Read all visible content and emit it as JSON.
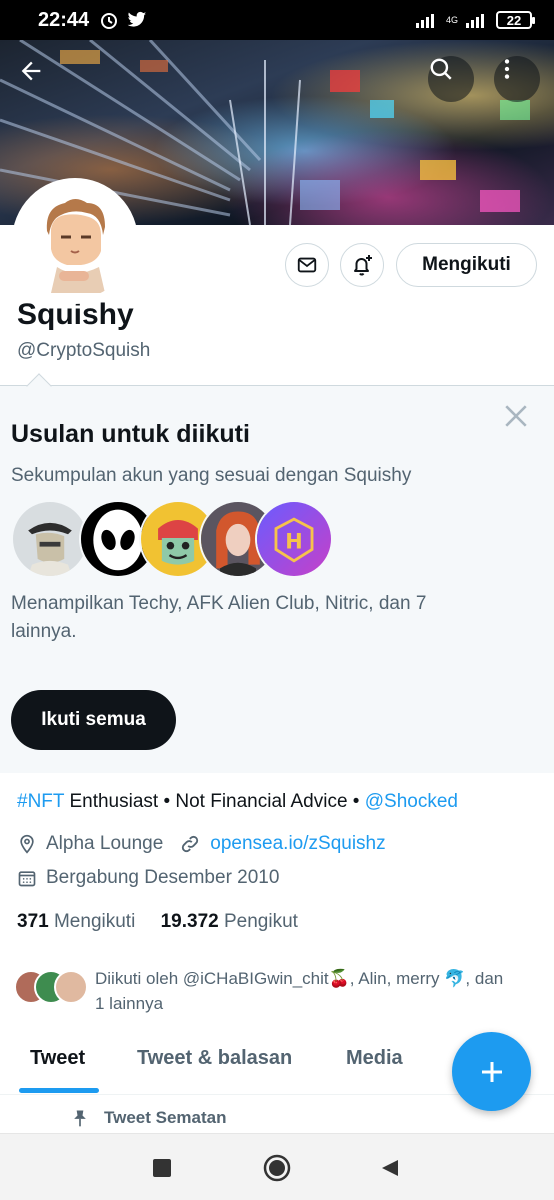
{
  "status_bar": {
    "time": "22:44",
    "network": "4G",
    "battery": "22"
  },
  "header": {
    "back_icon": "arrow-left-icon",
    "search_icon": "search-icon",
    "more_icon": "more-vertical-icon"
  },
  "profile": {
    "name": "Squishy",
    "handle": "@CryptoSquish",
    "follow_button": "Mengikuti",
    "bio_hashtag": "#NFT",
    "bio_middle": " Enthusiast • Not Financial Advice • ",
    "bio_mention": "@Shocked",
    "location": "Alpha Lounge",
    "website": "opensea.io/zSquishz",
    "joined": "Bergabung Desember 2010",
    "following_count": "371",
    "following_label": "Mengikuti",
    "followers_count": "19.372",
    "followers_label": "Pengikut",
    "followed_by_line1": "Diikuti oleh @iCHaBIGwin_chit🍒, Alin, merry 🐬, dan",
    "followed_by_line2": "1 lainnya"
  },
  "suggestions": {
    "title": "Usulan untuk diikuti",
    "subtitle": "Sekumpulan akun yang sesuai dengan Squishy",
    "description_line1": "Menampilkan Techy, AFK Alien Club, Nitric, dan 7",
    "description_line2": "lainnya.",
    "follow_all": "Ikuti semua"
  },
  "tabs": [
    {
      "label": "Tweet"
    },
    {
      "label": "Tweet & balasan"
    },
    {
      "label": "Media"
    }
  ],
  "pinned_label": "Tweet Sematan",
  "colors": {
    "accent": "#1d9bf0",
    "text_primary": "#0f1419",
    "text_secondary": "#536471",
    "panel_bg": "#f5f8fa"
  }
}
